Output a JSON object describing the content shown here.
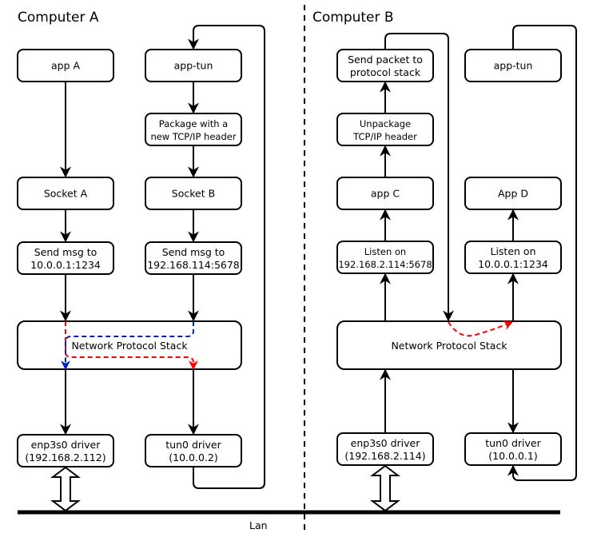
{
  "computer_a": {
    "title": "Computer A",
    "nodes": {
      "app_a": [
        "app A"
      ],
      "app_tun": [
        "app-tun"
      ],
      "package": [
        "Package with a",
        "new TCP/IP header"
      ],
      "socket_a": [
        "Socket A"
      ],
      "socket_b": [
        "Socket B"
      ],
      "send_msg_a": [
        "Send msg to",
        "10.0.0.1:1234"
      ],
      "send_msg_b": [
        "Send msg to",
        "192.168.114:5678"
      ],
      "network_stack": [
        "Network Protocol Stack"
      ],
      "enp3s0": [
        "enp3s0 driver",
        "(192.168.2.112)"
      ],
      "tun0": [
        "tun0 driver",
        "(10.0.0.2)"
      ]
    }
  },
  "computer_b": {
    "title": "Computer B",
    "nodes": {
      "send_packet": [
        "Send packet to",
        "protocol stack"
      ],
      "app_tun": [
        "app-tun"
      ],
      "unpackage": [
        "Unpackage",
        "TCP/IP header"
      ],
      "app_c": [
        "app C"
      ],
      "app_d": [
        "App D"
      ],
      "listen_c": [
        "Listen on",
        "192.168.2.114:5678"
      ],
      "listen_d": [
        "Listen on",
        "10.0.0.1:1234"
      ],
      "network_stack": [
        "Network Protocol Stack"
      ],
      "enp3s0": [
        "enp3s0 driver",
        "(192.168.2.114)"
      ],
      "tun0": [
        "tun0 driver",
        "(10.0.0.1)"
      ]
    }
  },
  "network": {
    "label": "Lan"
  },
  "colors": {
    "route_red": "#ff0000",
    "route_blue": "#0022bb",
    "stroke": "#000000"
  }
}
